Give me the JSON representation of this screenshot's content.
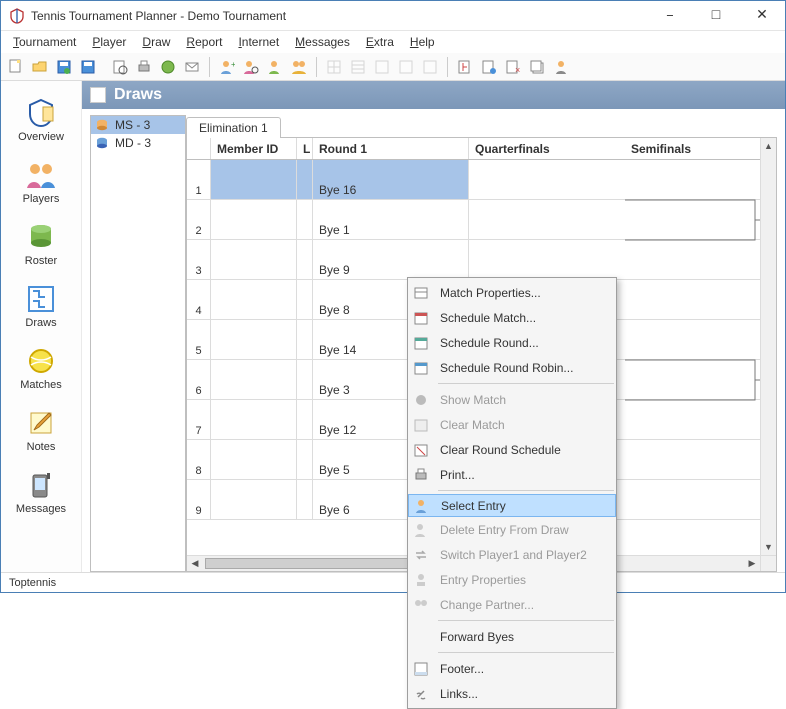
{
  "window": {
    "title": "Tennis Tournament Planner - Demo Tournament"
  },
  "menu": [
    "Tournament",
    "Player",
    "Draw",
    "Report",
    "Internet",
    "Messages",
    "Extra",
    "Help"
  ],
  "sidebar": [
    {
      "label": "Overview",
      "icon": "overview"
    },
    {
      "label": "Players",
      "icon": "players"
    },
    {
      "label": "Roster",
      "icon": "roster"
    },
    {
      "label": "Draws",
      "icon": "draws"
    },
    {
      "label": "Matches",
      "icon": "matches"
    },
    {
      "label": "Notes",
      "icon": "notes"
    },
    {
      "label": "Messages",
      "icon": "messages"
    }
  ],
  "section_title": "Draws",
  "events": [
    {
      "label": "MS - 3",
      "active": true,
      "color": "#e8a23a"
    },
    {
      "label": "MD - 3",
      "active": false,
      "color": "#3a63b5"
    }
  ],
  "tabs": [
    {
      "label": "Elimination 1",
      "active": true
    }
  ],
  "columns": {
    "member_id": "Member ID",
    "l": "L",
    "round1": "Round 1",
    "quarterfinals": "Quarterfinals",
    "semifinals": "Semifinals"
  },
  "rows": [
    {
      "num": "1",
      "member_id": "",
      "l": "",
      "round1": "Bye 16",
      "highlight": true
    },
    {
      "num": "2",
      "member_id": "",
      "l": "",
      "round1": "Bye 1"
    },
    {
      "num": "3",
      "member_id": "",
      "l": "",
      "round1": "Bye 9"
    },
    {
      "num": "4",
      "member_id": "",
      "l": "",
      "round1": "Bye 8"
    },
    {
      "num": "5",
      "member_id": "",
      "l": "",
      "round1": "Bye 14"
    },
    {
      "num": "6",
      "member_id": "",
      "l": "",
      "round1": "Bye 3"
    },
    {
      "num": "7",
      "member_id": "",
      "l": "",
      "round1": "Bye 12"
    },
    {
      "num": "8",
      "member_id": "",
      "l": "",
      "round1": "Bye 5"
    },
    {
      "num": "9",
      "member_id": "",
      "l": "",
      "round1": "Bye 6"
    }
  ],
  "context_menu": [
    {
      "label": "Match Properties...",
      "icon": "props",
      "enabled": true
    },
    {
      "label": "Schedule Match...",
      "icon": "cal",
      "enabled": true
    },
    {
      "label": "Schedule Round...",
      "icon": "cal2",
      "enabled": true
    },
    {
      "label": "Schedule Round Robin...",
      "icon": "cal3",
      "enabled": true
    },
    {
      "sep": true
    },
    {
      "label": "Show Match",
      "icon": "dot",
      "enabled": false
    },
    {
      "label": "Clear Match",
      "icon": "clear",
      "enabled": false
    },
    {
      "label": "Clear Round Schedule",
      "icon": "clear2",
      "enabled": true
    },
    {
      "label": "Print...",
      "icon": "print",
      "enabled": true
    },
    {
      "sep": true
    },
    {
      "label": "Select Entry",
      "icon": "entry",
      "enabled": true,
      "highlight": true
    },
    {
      "label": "Delete Entry From Draw",
      "icon": "delentry",
      "enabled": false
    },
    {
      "label": "Switch Player1 and Player2",
      "icon": "swap",
      "enabled": false
    },
    {
      "label": "Entry Properties",
      "icon": "eprops",
      "enabled": false
    },
    {
      "label": "Change Partner...",
      "icon": "partner",
      "enabled": false
    },
    {
      "sep": true
    },
    {
      "label": "Forward Byes",
      "icon": "",
      "enabled": true
    },
    {
      "sep": true
    },
    {
      "label": "Footer...",
      "icon": "footer",
      "enabled": true
    },
    {
      "label": "Links...",
      "icon": "link",
      "enabled": true
    }
  ],
  "status": "Toptennis"
}
